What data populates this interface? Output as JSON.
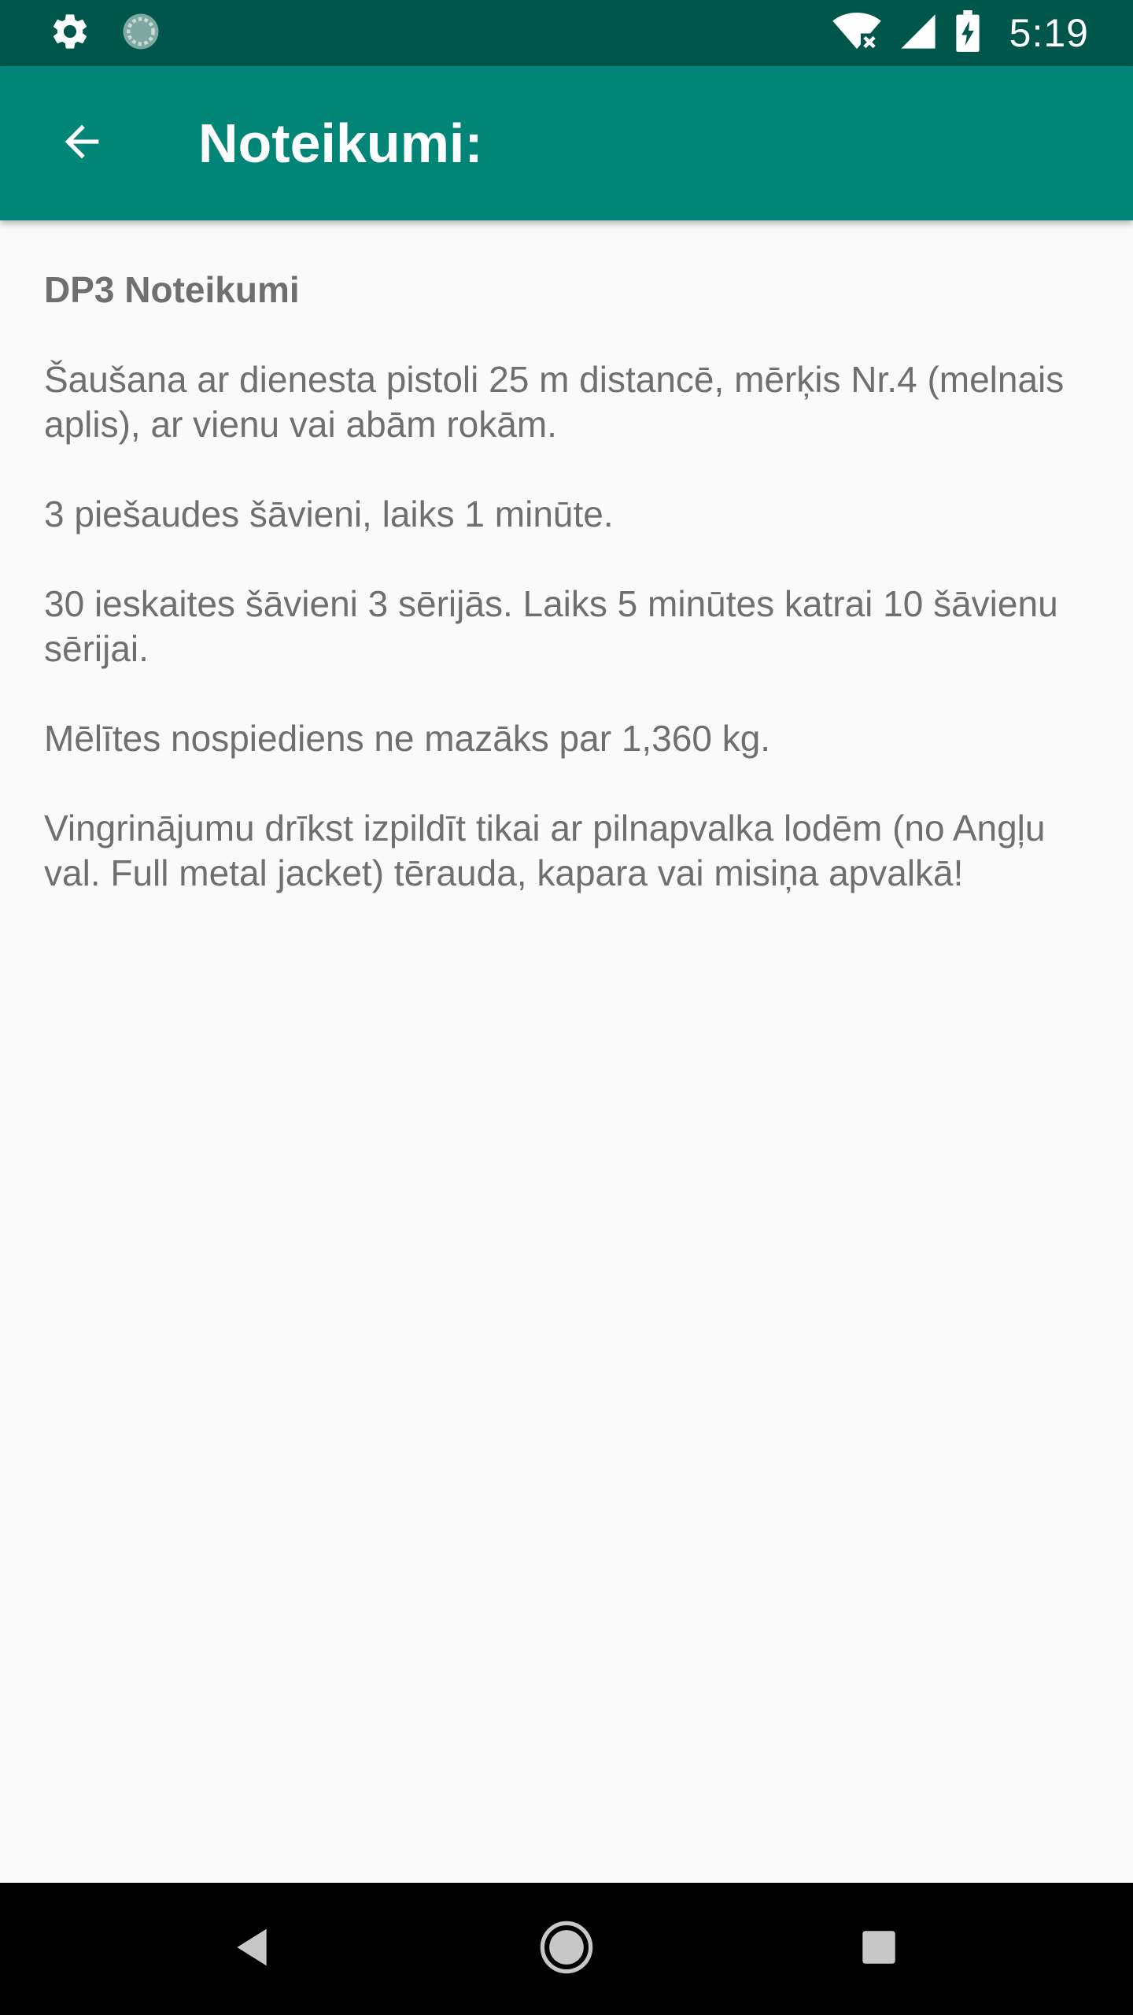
{
  "status_bar": {
    "time": "5:19",
    "icons": [
      "gear-icon",
      "sync-icon",
      "wifi-icon",
      "signal-icon",
      "battery-charging-icon"
    ]
  },
  "app_bar": {
    "title": "Noteikumi:",
    "back_icon": "arrow-back-icon",
    "background_color": "#008577",
    "status_color": "#00564b"
  },
  "content": {
    "heading": "DP3 Noteikumi",
    "paragraphs": [
      "Šaušana ar dienesta pistoli 25 m distancē, mērķis Nr.4 (melnais aplis), ar vienu vai abām rokām.",
      "3 piešaudes šāvieni, laiks 1 minūte.",
      "30 ieskaites šāvieni 3 sērijās. Laiks 5 minūtes katrai 10 šāvienu sērijai.",
      "Mēlītes nospiediens ne mazāks par 1,360 kg.",
      "Vingrinājumu drīkst izpildīt tikai ar pilnapvalka lodēm (no Angļu val. Full metal jacket) tērauda, kapara vai misiņa apvalkā!"
    ]
  },
  "nav_bar": {
    "buttons": [
      "back-triangle-icon",
      "home-circle-icon",
      "recents-square-icon"
    ]
  }
}
